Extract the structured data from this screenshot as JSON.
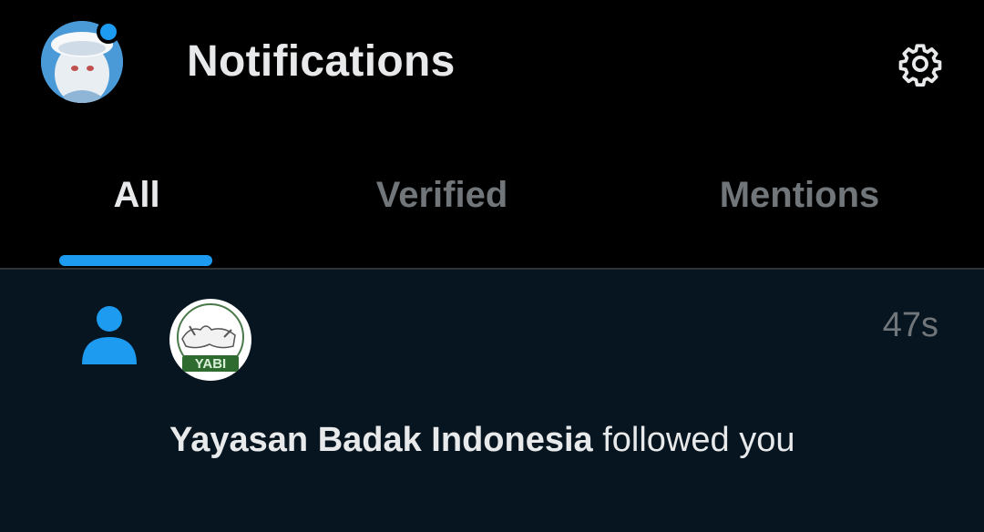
{
  "header": {
    "title": "Notifications",
    "avatar_icon": "profile-avatar",
    "settings_icon": "gear-icon"
  },
  "tabs": [
    {
      "label": "All",
      "active": true
    },
    {
      "label": "Verified",
      "active": false
    },
    {
      "label": "Mentions",
      "active": false
    }
  ],
  "notification": {
    "type_icon": "person-icon",
    "avatar_text": "YABI",
    "account_name": "Yayasan Badak Indonesia",
    "action": " followed you",
    "time": "47s"
  },
  "colors": {
    "accent": "#1d9bf0",
    "background": "#000000",
    "unread_background": "#061520",
    "muted_text": "#71767b",
    "primary_text": "#e7e9ea"
  }
}
